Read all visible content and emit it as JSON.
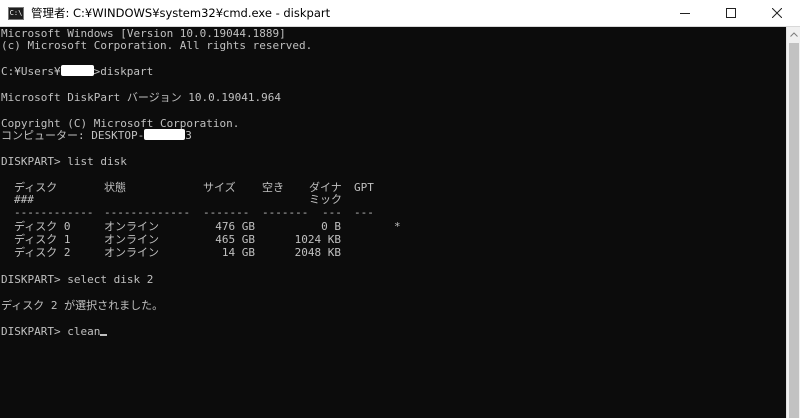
{
  "window": {
    "title": "管理者: C:¥WINDOWS¥system32¥cmd.exe - diskpart",
    "app_icon_text": "C:\\",
    "minimize_icon": "minimize-icon",
    "maximize_icon": "maximize-icon",
    "close_icon": "close-icon"
  },
  "console": {
    "header_line1": "Microsoft Windows [Version 10.0.19044.1889]",
    "header_line2": "(c) Microsoft Corporation. All rights reserved.",
    "prompt1_prefix": "C:¥Users¥",
    "prompt1_cmd": ">diskpart",
    "diskpart_version": "Microsoft DiskPart バージョン 10.0.19041.964",
    "copyright": "Copyright (C) Microsoft Corporation.",
    "computer_prefix": "コンピューター: DESKTOP-",
    "computer_suffix": "3",
    "prompt2": "DISKPART> list disk",
    "prompt3": "DISKPART> select disk 2",
    "result3": "ディスク 2 が選択されました。",
    "prompt4": "DISKPART> clean"
  },
  "disk_table": {
    "headers": {
      "disk": "ディスク",
      "disk_num": "###",
      "status": "状態",
      "size": "サイズ",
      "free": "空き",
      "dyn": "ダイナ",
      "dyn2": "ミック",
      "gpt": "GPT"
    },
    "separators": {
      "disk": "------------",
      "status": "-------------",
      "size": "-------",
      "free": "-------",
      "dyn": "---",
      "gpt": "---"
    },
    "rows": [
      {
        "disk": "ディスク 0",
        "status": "オンライン",
        "size": "476 GB",
        "free": "0 B",
        "dyn": "",
        "gpt": "*"
      },
      {
        "disk": "ディスク 1",
        "status": "オンライン",
        "size": "465 GB",
        "free": "1024 KB",
        "dyn": "",
        "gpt": ""
      },
      {
        "disk": "ディスク 2",
        "status": "オンライン",
        "size": "14 GB",
        "free": "2048 KB",
        "dyn": "",
        "gpt": ""
      }
    ]
  }
}
